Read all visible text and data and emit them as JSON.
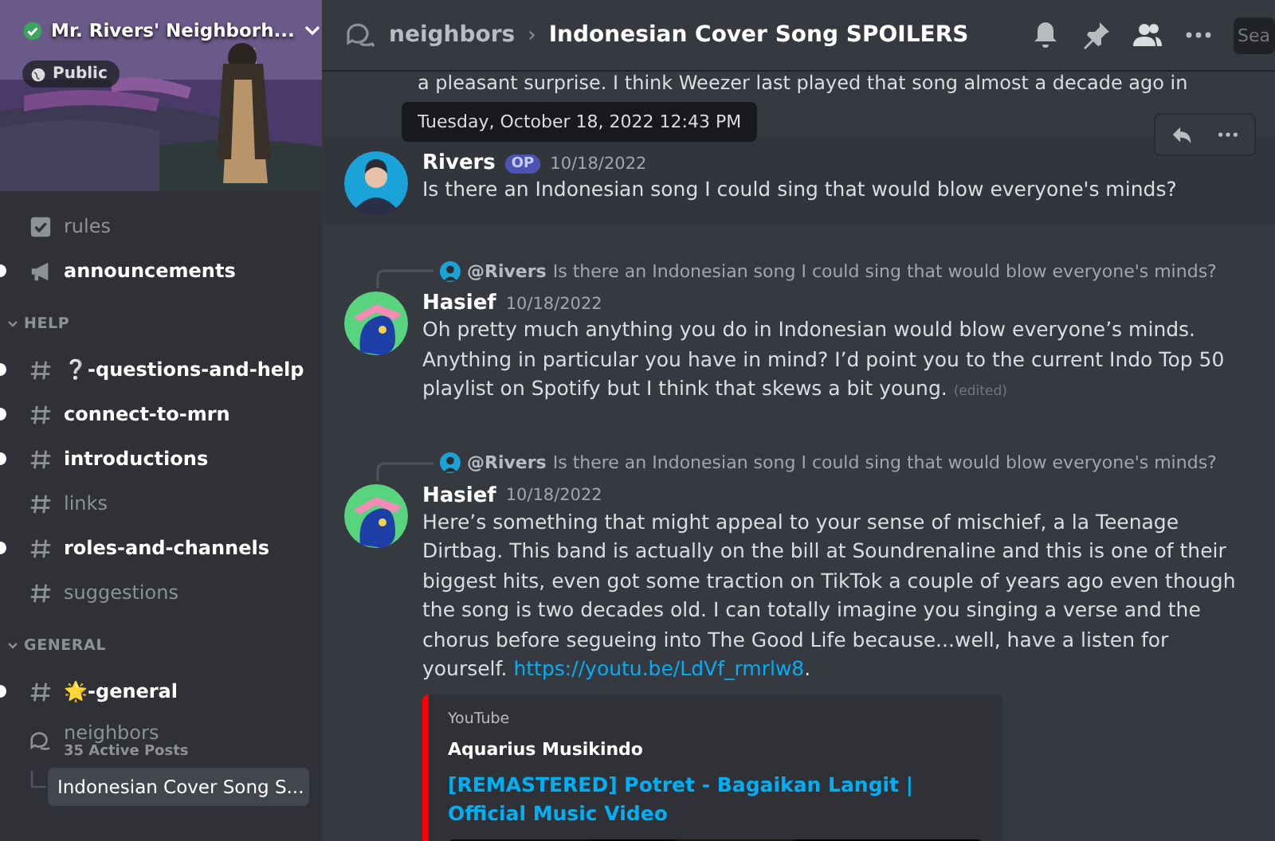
{
  "server": {
    "name": "Mr. Rivers' Neighborh...",
    "verified": true,
    "badge": "Public"
  },
  "sidebar": {
    "top_channels": [
      {
        "name": "rules",
        "kind": "rules",
        "unread": false
      },
      {
        "name": "announcements",
        "kind": "announcements",
        "unread": true
      }
    ],
    "categories": [
      {
        "name": "HELP",
        "expanded": true,
        "channels": [
          {
            "name": "❔-questions-and-help",
            "kind": "text",
            "unread": true
          },
          {
            "name": "connect-to-mrn",
            "kind": "text",
            "unread": true
          },
          {
            "name": "introductions",
            "kind": "text",
            "unread": true
          },
          {
            "name": "links",
            "kind": "text",
            "unread": false
          },
          {
            "name": "roles-and-channels",
            "kind": "text",
            "unread": true
          },
          {
            "name": "suggestions",
            "kind": "text",
            "unread": false
          }
        ]
      },
      {
        "name": "GENERAL",
        "expanded": true,
        "channels": [
          {
            "name": "🌟-general",
            "kind": "text",
            "unread": true
          },
          {
            "name": "neighbors",
            "kind": "forum",
            "unread": false,
            "subtitle": "35 Active Posts",
            "children": [
              {
                "name": "Indonesian Cover Song S...",
                "selected": true
              }
            ]
          }
        ]
      }
    ]
  },
  "header": {
    "parent": "neighbors",
    "separator": "›",
    "title": "Indonesian Cover Song SPOILERS",
    "search_placeholder": "Sea"
  },
  "partial_text": "a pleasant surprise. I think Weezer last played that song almost a decade ago in",
  "tooltip": "Tuesday, October 18, 2022 12:43 PM",
  "messages": [
    {
      "author": "Rivers",
      "badge": "OP",
      "date": "10/18/2022",
      "hovered": true,
      "text": "Is there an Indonesian song I could sing that would blow everyone's minds?"
    },
    {
      "reply": {
        "author": "@Rivers",
        "text": "Is there an Indonesian song I could sing that would blow everyone's minds?"
      },
      "author": "Hasief",
      "date": "10/18/2022",
      "hovered": false,
      "text": "Oh pretty much anything you do in Indonesian would blow everyone’s minds. Anything in particular you have in mind? I’d point you to the current Indo Top 50 playlist on Spotify but I think that skews a bit young.",
      "edited": "(edited)"
    },
    {
      "reply": {
        "author": "@Rivers",
        "text": "Is there an Indonesian song I could sing that would blow everyone's minds?"
      },
      "author": "Hasief",
      "date": "10/18/2022",
      "hovered": false,
      "text": "Here’s something that might appeal to your sense of mischief, a la Teenage Dirtbag. This band is actually on the bill at Soundrenaline and this is one of their biggest hits, even got some traction on TikTok a couple of years ago even though the song is two decades old. I can totally imagine you singing a verse and the chorus before segueing into The Good Life because...well, have a listen for yourself.",
      "link": "https://youtu.be/LdVf_rmrlw8",
      "text_after": ".",
      "embed": {
        "provider": "YouTube",
        "author": "Aquarius Musikindo",
        "title": "[REMASTERED] Potret - Bagaikan Langit | Official Music Video",
        "color": "#ff0000",
        "kind": "picture"
      }
    }
  ]
}
